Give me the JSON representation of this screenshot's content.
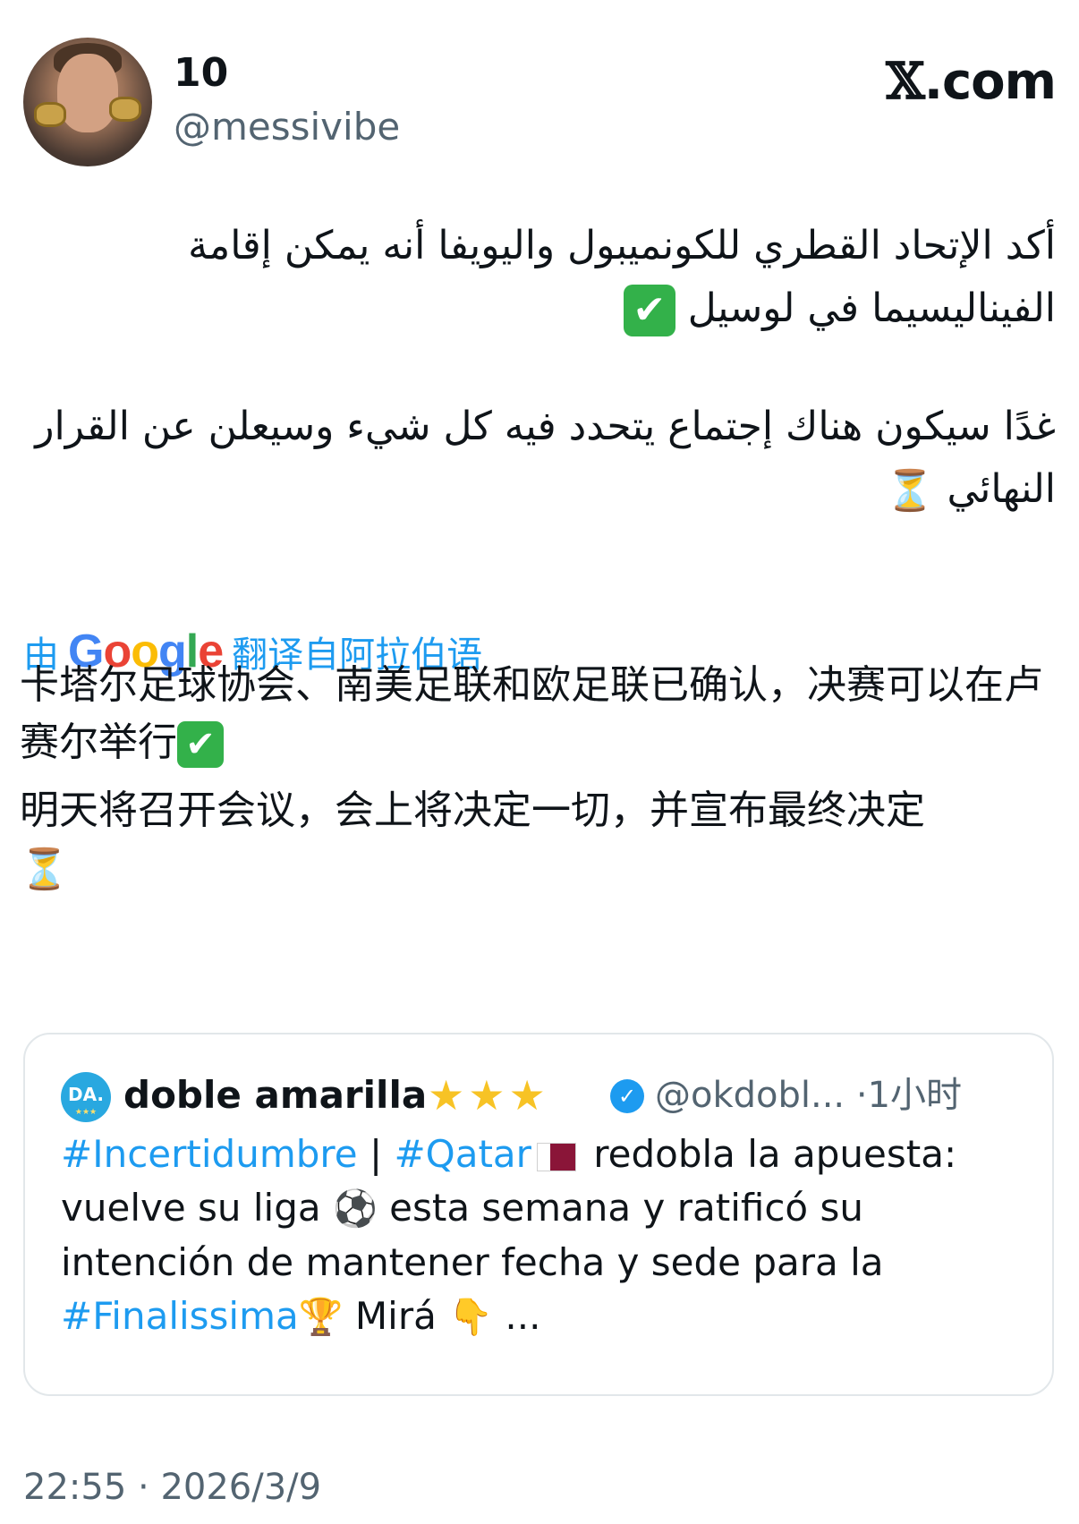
{
  "author": {
    "display_name": "10",
    "handle": "@messivibe"
  },
  "brand": {
    "x_mark": "𝕏",
    "domain": ".com"
  },
  "original_text": {
    "paragraph1_text": "أكد الإتحاد القطري للكونميبول واليويفا أنه يمكن إقامة الفيناليسيما في لوسيل",
    "paragraph1_emoji": "✔",
    "paragraph2_text": "غدًا سيكون هناك إجتماع يتحدد فيه كل شيء وسيعلن عن القرار النهائي",
    "paragraph2_emoji": "⏳"
  },
  "translation_note": {
    "prefix": "由",
    "provider": "Google",
    "suffix": "翻译自阿拉伯语"
  },
  "translated_text": {
    "line1": "卡塔尔足球协会、南美足联和欧足联已确认，决赛可以在卢赛尔举行",
    "line1_emoji": "✔",
    "line2": "明天将召开会议，会上将决定一切，并宣布最终决定",
    "line2_emoji": "⏳"
  },
  "quoted_tweet": {
    "avatar_text": "DA.",
    "avatar_stars": "★★★",
    "name": "doble amarilla",
    "name_stars": "★★★",
    "verified_icon": "✓",
    "handle": "@okdobl...",
    "separator": "·",
    "time": "1小时",
    "hashtag1": "#Incertidumbre",
    "pipe": "|",
    "hashtag2": "#Qatar",
    "text1": "redobla la apuesta: vuelve su liga",
    "soccer_emoji": "⚽",
    "text2": "esta semana y ratificó su intención de mantener fecha y sede para la",
    "hashtag3": "#Finalissima",
    "trophy_emoji": "🏆",
    "text3": "Mirá",
    "pointing_emoji": "👇",
    "ellipsis": "..."
  },
  "timestamp": {
    "time": "22:55",
    "separator": "·",
    "date": "2026/3/9"
  },
  "colors": {
    "link_blue": "#1d9bf0",
    "secondary_text": "#536471",
    "check_green": "#33b14a",
    "border": "#e2e7ea"
  }
}
